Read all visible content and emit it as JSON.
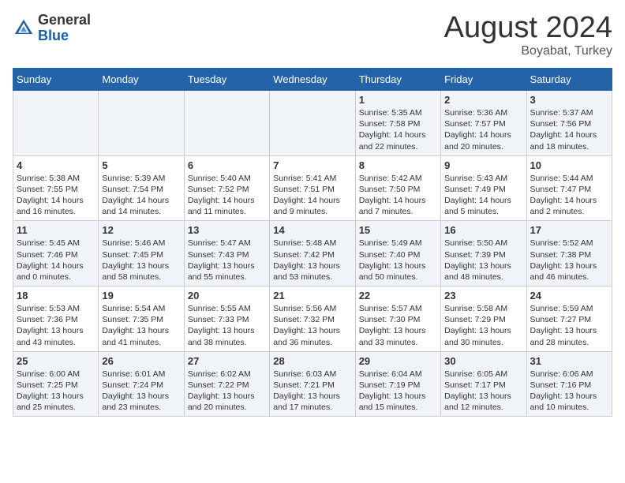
{
  "header": {
    "logo_general": "General",
    "logo_blue": "Blue",
    "month_year": "August 2024",
    "location": "Boyabat, Turkey"
  },
  "days_of_week": [
    "Sunday",
    "Monday",
    "Tuesday",
    "Wednesday",
    "Thursday",
    "Friday",
    "Saturday"
  ],
  "weeks": [
    [
      {
        "day": "",
        "info": ""
      },
      {
        "day": "",
        "info": ""
      },
      {
        "day": "",
        "info": ""
      },
      {
        "day": "",
        "info": ""
      },
      {
        "day": "1",
        "info": "Sunrise: 5:35 AM\nSunset: 7:58 PM\nDaylight: 14 hours\nand 22 minutes."
      },
      {
        "day": "2",
        "info": "Sunrise: 5:36 AM\nSunset: 7:57 PM\nDaylight: 14 hours\nand 20 minutes."
      },
      {
        "day": "3",
        "info": "Sunrise: 5:37 AM\nSunset: 7:56 PM\nDaylight: 14 hours\nand 18 minutes."
      }
    ],
    [
      {
        "day": "4",
        "info": "Sunrise: 5:38 AM\nSunset: 7:55 PM\nDaylight: 14 hours\nand 16 minutes."
      },
      {
        "day": "5",
        "info": "Sunrise: 5:39 AM\nSunset: 7:54 PM\nDaylight: 14 hours\nand 14 minutes."
      },
      {
        "day": "6",
        "info": "Sunrise: 5:40 AM\nSunset: 7:52 PM\nDaylight: 14 hours\nand 11 minutes."
      },
      {
        "day": "7",
        "info": "Sunrise: 5:41 AM\nSunset: 7:51 PM\nDaylight: 14 hours\nand 9 minutes."
      },
      {
        "day": "8",
        "info": "Sunrise: 5:42 AM\nSunset: 7:50 PM\nDaylight: 14 hours\nand 7 minutes."
      },
      {
        "day": "9",
        "info": "Sunrise: 5:43 AM\nSunset: 7:49 PM\nDaylight: 14 hours\nand 5 minutes."
      },
      {
        "day": "10",
        "info": "Sunrise: 5:44 AM\nSunset: 7:47 PM\nDaylight: 14 hours\nand 2 minutes."
      }
    ],
    [
      {
        "day": "11",
        "info": "Sunrise: 5:45 AM\nSunset: 7:46 PM\nDaylight: 14 hours\nand 0 minutes."
      },
      {
        "day": "12",
        "info": "Sunrise: 5:46 AM\nSunset: 7:45 PM\nDaylight: 13 hours\nand 58 minutes."
      },
      {
        "day": "13",
        "info": "Sunrise: 5:47 AM\nSunset: 7:43 PM\nDaylight: 13 hours\nand 55 minutes."
      },
      {
        "day": "14",
        "info": "Sunrise: 5:48 AM\nSunset: 7:42 PM\nDaylight: 13 hours\nand 53 minutes."
      },
      {
        "day": "15",
        "info": "Sunrise: 5:49 AM\nSunset: 7:40 PM\nDaylight: 13 hours\nand 50 minutes."
      },
      {
        "day": "16",
        "info": "Sunrise: 5:50 AM\nSunset: 7:39 PM\nDaylight: 13 hours\nand 48 minutes."
      },
      {
        "day": "17",
        "info": "Sunrise: 5:52 AM\nSunset: 7:38 PM\nDaylight: 13 hours\nand 46 minutes."
      }
    ],
    [
      {
        "day": "18",
        "info": "Sunrise: 5:53 AM\nSunset: 7:36 PM\nDaylight: 13 hours\nand 43 minutes."
      },
      {
        "day": "19",
        "info": "Sunrise: 5:54 AM\nSunset: 7:35 PM\nDaylight: 13 hours\nand 41 minutes."
      },
      {
        "day": "20",
        "info": "Sunrise: 5:55 AM\nSunset: 7:33 PM\nDaylight: 13 hours\nand 38 minutes."
      },
      {
        "day": "21",
        "info": "Sunrise: 5:56 AM\nSunset: 7:32 PM\nDaylight: 13 hours\nand 36 minutes."
      },
      {
        "day": "22",
        "info": "Sunrise: 5:57 AM\nSunset: 7:30 PM\nDaylight: 13 hours\nand 33 minutes."
      },
      {
        "day": "23",
        "info": "Sunrise: 5:58 AM\nSunset: 7:29 PM\nDaylight: 13 hours\nand 30 minutes."
      },
      {
        "day": "24",
        "info": "Sunrise: 5:59 AM\nSunset: 7:27 PM\nDaylight: 13 hours\nand 28 minutes."
      }
    ],
    [
      {
        "day": "25",
        "info": "Sunrise: 6:00 AM\nSunset: 7:25 PM\nDaylight: 13 hours\nand 25 minutes."
      },
      {
        "day": "26",
        "info": "Sunrise: 6:01 AM\nSunset: 7:24 PM\nDaylight: 13 hours\nand 23 minutes."
      },
      {
        "day": "27",
        "info": "Sunrise: 6:02 AM\nSunset: 7:22 PM\nDaylight: 13 hours\nand 20 minutes."
      },
      {
        "day": "28",
        "info": "Sunrise: 6:03 AM\nSunset: 7:21 PM\nDaylight: 13 hours\nand 17 minutes."
      },
      {
        "day": "29",
        "info": "Sunrise: 6:04 AM\nSunset: 7:19 PM\nDaylight: 13 hours\nand 15 minutes."
      },
      {
        "day": "30",
        "info": "Sunrise: 6:05 AM\nSunset: 7:17 PM\nDaylight: 13 hours\nand 12 minutes."
      },
      {
        "day": "31",
        "info": "Sunrise: 6:06 AM\nSunset: 7:16 PM\nDaylight: 13 hours\nand 10 minutes."
      }
    ]
  ]
}
